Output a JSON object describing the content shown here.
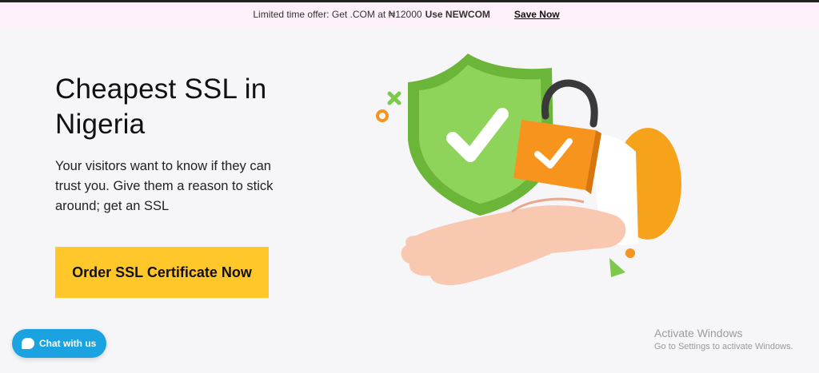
{
  "promo": {
    "text": "Limited time offer: Get .COM at ₦12000",
    "code": "Use NEWCOM",
    "link": "Save Now"
  },
  "hero": {
    "title": "Cheapest SSL  in Nigeria",
    "subtitle": "Your visitors want to know if they can trust you. Give them a reason to stick around; get an SSL",
    "button": "Order SSL Certificate Now"
  },
  "illustration": {
    "name": "hand-holding-shield-and-padlock"
  },
  "chat": {
    "label": "Chat with us"
  },
  "watermark": {
    "title": "Activate Windows",
    "subtitle": "Go to Settings to activate Windows."
  },
  "colors": {
    "accent": "#ffc72a",
    "promo_bg": "#fdf0fa",
    "chat": "#1ba2e0",
    "shield": "#7ec84a",
    "padlock": "#f7941d"
  }
}
